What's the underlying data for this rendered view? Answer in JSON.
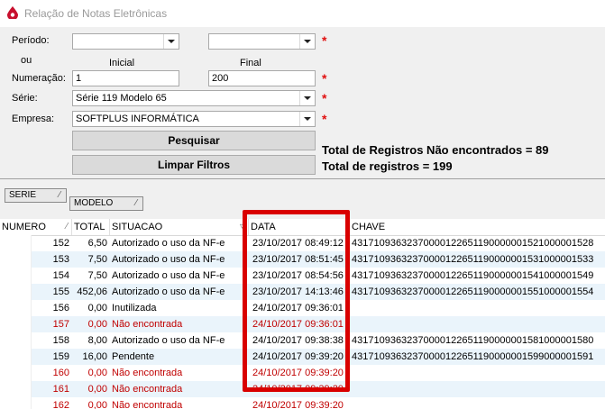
{
  "window": {
    "title": "Relação de Notas Eletrônicas"
  },
  "form": {
    "periodo_label": "Período:",
    "ou_label": "ou",
    "inicial_label": "Inicial",
    "final_label": "Final",
    "periodo_inicial": "",
    "periodo_final": "",
    "numeracao_label": "Numeração:",
    "numeracao_inicial": "1",
    "numeracao_final": "200",
    "serie_label": "Série:",
    "serie_value": "Série 119 Modelo 65",
    "empresa_label": "Empresa:",
    "empresa_value": "SOFTPLUS INFORMÁTICA",
    "required_mark": "*",
    "pesquisar_label": "Pesquisar",
    "limpar_label": "Limpar Filtros",
    "total_nao_encontrados": "Total de Registros Não encontrados = 89",
    "total_registros": "Total de registros = 199"
  },
  "grouping": {
    "serie": "SERIE",
    "modelo": "MODELO"
  },
  "grid": {
    "columns": [
      "NUMERO",
      "TOTAL",
      "SITUACAO",
      "DATA",
      "CHAVE"
    ],
    "rows": [
      {
        "numero": "152",
        "total": "6,50",
        "situacao": "Autorizado o uso da NF-e",
        "data": "23/10/2017 08:49:12",
        "chave": "43171093632370000122651190000001521000001528",
        "red": false
      },
      {
        "numero": "153",
        "total": "7,50",
        "situacao": "Autorizado o uso da NF-e",
        "data": "23/10/2017 08:51:45",
        "chave": "43171093632370000122651190000001531000001533",
        "red": false
      },
      {
        "numero": "154",
        "total": "7,50",
        "situacao": "Autorizado o uso da NF-e",
        "data": "23/10/2017 08:54:56",
        "chave": "43171093632370000122651190000001541000001549",
        "red": false
      },
      {
        "numero": "155",
        "total": "452,06",
        "situacao": "Autorizado o uso da NF-e",
        "data": "23/10/2017 14:13:46",
        "chave": "43171093632370000122651190000001551000001554",
        "red": false
      },
      {
        "numero": "156",
        "total": "0,00",
        "situacao": "Inutilizada",
        "data": "24/10/2017 09:36:01",
        "chave": "",
        "red": false
      },
      {
        "numero": "157",
        "total": "0,00",
        "situacao": "Não encontrada",
        "data": "24/10/2017 09:36:01",
        "chave": "",
        "red": true
      },
      {
        "numero": "158",
        "total": "8,00",
        "situacao": "Autorizado o uso da NF-e",
        "data": "24/10/2017 09:38:38",
        "chave": "43171093632370000122651190000001581000001580",
        "red": false
      },
      {
        "numero": "159",
        "total": "16,00",
        "situacao": "Pendente",
        "data": "24/10/2017 09:39:20",
        "chave": "43171093632370000122651190000001599000001591",
        "red": false
      },
      {
        "numero": "160",
        "total": "0,00",
        "situacao": "Não encontrada",
        "data": "24/10/2017 09:39:20",
        "chave": "",
        "red": true
      },
      {
        "numero": "161",
        "total": "0,00",
        "situacao": "Não encontrada",
        "data": "24/10/2017 09:39:20",
        "chave": "",
        "red": true
      },
      {
        "numero": "162",
        "total": "0,00",
        "situacao": "Não encontrada",
        "data": "24/10/2017 09:39:20",
        "chave": "",
        "red": true
      }
    ]
  },
  "colors": {
    "highlight": "#d90000",
    "error_text": "#c00000",
    "alt_row": "#eaf4fb"
  }
}
